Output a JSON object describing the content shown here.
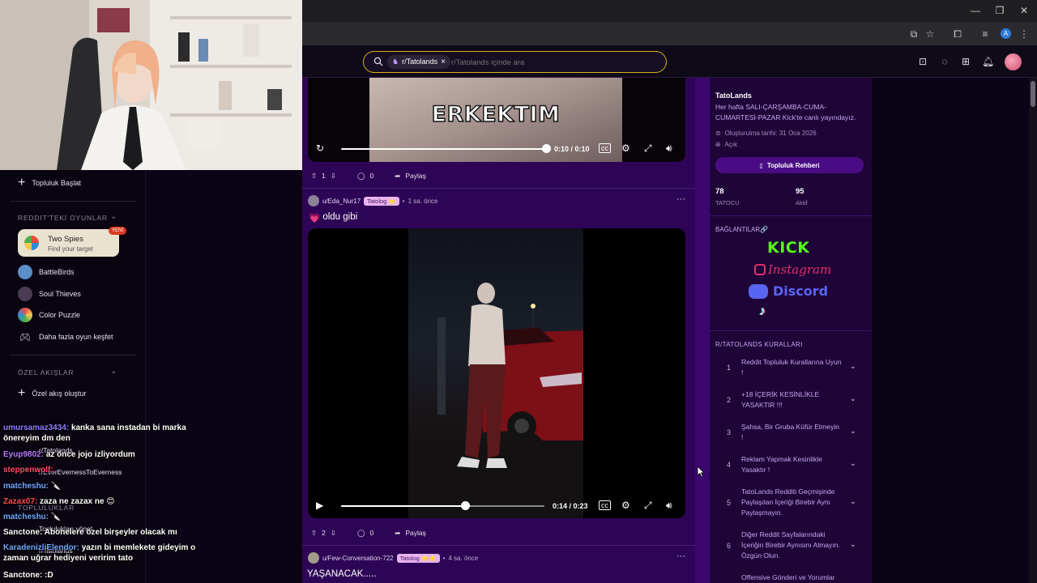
{
  "browser": {
    "window_controls": [
      "—",
      "❐",
      "✕"
    ],
    "profile_initial": "A"
  },
  "search": {
    "chip_label": "r/Tatolands",
    "placeholder": "r/Tatolands içinde ara"
  },
  "sidebar": {
    "start_community": "Topluluk Başlat",
    "games_heading": "REDDIT'TEKİ OYUNLAR",
    "featured_game": {
      "name": "Two Spies",
      "subtitle": "Find your target",
      "badge": "YENİ"
    },
    "games": [
      "BattleBirds",
      "Soul Thieves",
      "Color Puzzle"
    ],
    "discover_more": "Daha fazla oyun keşfet",
    "custom_feeds_heading": "ÖZEL AKIŞLAR",
    "create_feed": "Özel akış oluştur"
  },
  "post1": {
    "overlay_text": "ERKEKTIM",
    "time": "0:10 / 0:10",
    "progress": 1.0,
    "upvotes": "1",
    "comments": "0",
    "share": "Paylaş"
  },
  "post2": {
    "author": "u/Eda_Nur17",
    "flair": "Tatolog ⭐",
    "age": "1 sa. önce",
    "title_emoji": "💗",
    "title": "oldu gibi",
    "time": "0:14 / 0:23",
    "progress": 0.61,
    "upvotes": "2",
    "comments": "0",
    "share": "Paylaş",
    "more": "···"
  },
  "post3": {
    "author": "u/Few-Conversation-722",
    "flair": "Tatolog ⭐⭐",
    "age": "4 sa. önce",
    "title": "YAŞANACAK.....",
    "more": "···"
  },
  "community": {
    "name": "TatoLands",
    "description": "Her hafta SALI-ÇARŞAMBA-CUMA-CUMARTESİ-PAZAR Kick'te canlı yayındayız.",
    "created": "Oluşturulma tarihi: 31 Oca 2026",
    "visibility": "Açık",
    "guide_button": "Topluluk Rehberi",
    "members_count": "78",
    "members_label": "TATOCU",
    "online_count": "95",
    "online_label": "Aktif",
    "links_heading": "BAĞLANTILAR🔗",
    "links": [
      "KICK",
      "Instagram",
      "Discord",
      "TikTok"
    ],
    "rules_heading": "R/TATOLANDS KURALLARI",
    "rules": [
      {
        "num": "1",
        "text": "Reddit Topluluk Kurallarına Uyun !"
      },
      {
        "num": "2",
        "text": "+18 İÇERİK KESİNLİKLE YASAKTIR !!!"
      },
      {
        "num": "3",
        "text": "Şahsa, Bir Gruba Küfür Etmeyin !"
      },
      {
        "num": "4",
        "text": "Reklam Yapmak Kesinlikle Yasaktır !"
      },
      {
        "num": "5",
        "text": "TatoLands Redditi Geçmişinde Paylaşılan İçeriği Birebir Aynı Paylaşmayın."
      },
      {
        "num": "6",
        "text": "Diğer Reddit Sayfalarındaki İçeriğin Birebir Aynısını Almayın. Özgün Olun."
      },
      {
        "num": "",
        "text": "Offensive Gönderi ve Yorumlar"
      }
    ]
  },
  "chat": [
    {
      "user": "umursamaz3434:",
      "msg": "kanka sana instadan bi marka önereyim dm den",
      "color": "#8f7cff"
    },
    {
      "user": "Eyup9802:",
      "msg": "az önce jojo izliyordum",
      "color": "#b77cff"
    },
    {
      "user": "steppenwolf:",
      "msg": "",
      "color": "#ff4d6d"
    },
    {
      "user": "matcheshu:",
      "msg": "🔪",
      "color": "#6fa8ff"
    },
    {
      "user": "Zazax07:",
      "msg": "zaza ne zazax ne 😊",
      "color": "#ff4d4d"
    },
    {
      "user": "matcheshu:",
      "msg": "🔪",
      "color": "#6fa8ff"
    },
    {
      "user": "Sanctone:",
      "msg": "Abonelere özel birşeyler olacak mı",
      "color": "#ffffff"
    },
    {
      "user": "KaradenizliElendor:",
      "msg": "yazın bi memlekete gideyim o zaman uğrar hediyeni veririm tato",
      "color": "#6fa8ff"
    },
    {
      "user": "Sanctone:",
      "msg": ":D",
      "color": "#ffffff"
    }
  ],
  "sidebar_underlay": {
    "recent_1": "r/Tatolands",
    "recent_2": "r/EverEvernessToEverness",
    "communities_heading": "TOPLULUKLAR",
    "manage": "Toplulukları yönet",
    "community_1": "r/Tatolands"
  }
}
